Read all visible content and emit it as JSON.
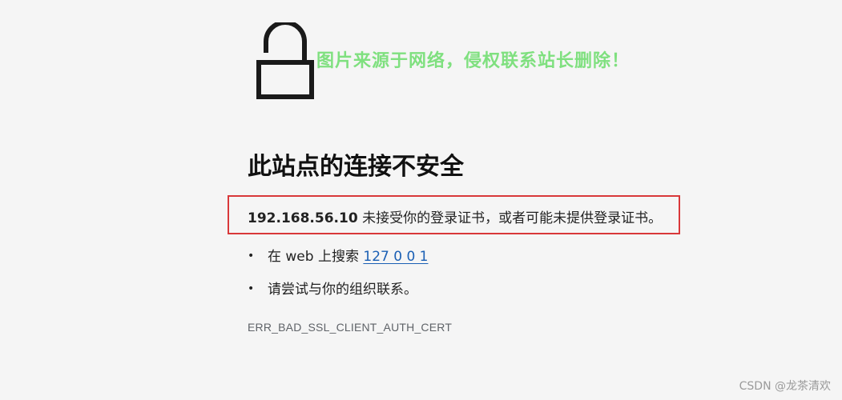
{
  "icons": {
    "lock": "unlocked-padlock-icon"
  },
  "watermark": "图片来源于网络，侵权联系站长删除！",
  "title": "此站点的连接不安全",
  "error": {
    "host": "192.168.56.10",
    "message": " 未接受你的登录证书，或者可能未提供登录证书。"
  },
  "suggestions": {
    "search_prefix": "在 web 上搜索 ",
    "search_link": "127 0 0 1",
    "contact": "请尝试与你的组织联系。"
  },
  "error_code": "ERR_BAD_SSL_CLIENT_AUTH_CERT",
  "credit": "CSDN @龙茶清欢",
  "colors": {
    "highlight_box": "#d9383a",
    "watermark": "#7fe07f",
    "link": "#1a5fb4"
  }
}
